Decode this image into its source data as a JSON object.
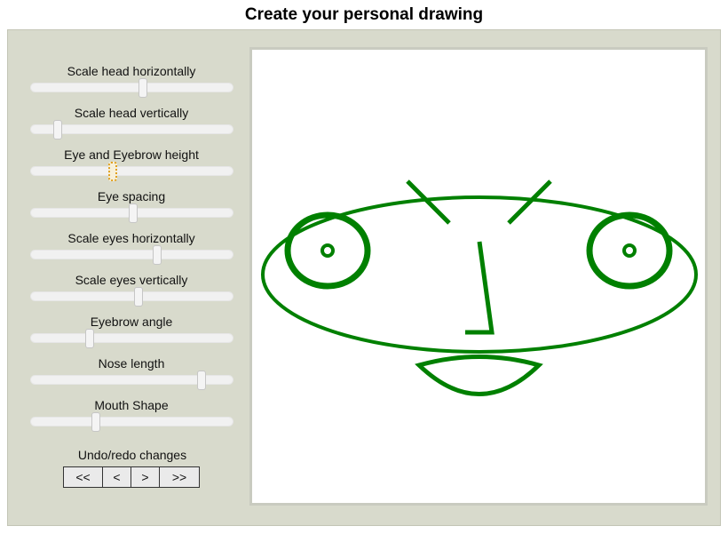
{
  "title": "Create your personal drawing",
  "controls": [
    {
      "label": "Scale head horizontally",
      "value": 0.55
    },
    {
      "label": "Scale head vertically",
      "value": 0.13
    },
    {
      "label": "Eye and Eyebrow height",
      "value": 0.4
    },
    {
      "label": "Eye spacing",
      "value": 0.5
    },
    {
      "label": "Scale eyes horizontally",
      "value": 0.62
    },
    {
      "label": "Scale eyes vertically",
      "value": 0.53
    },
    {
      "label": "Eyebrow angle",
      "value": 0.29
    },
    {
      "label": "Nose length",
      "value": 0.84
    },
    {
      "label": "Mouth Shape",
      "value": 0.32
    }
  ],
  "undo": {
    "label": "Undo/redo changes",
    "first": "<<",
    "prev": "<",
    "next": ">",
    "last": ">>"
  },
  "drawing": {
    "stroke_color": "#008000"
  }
}
